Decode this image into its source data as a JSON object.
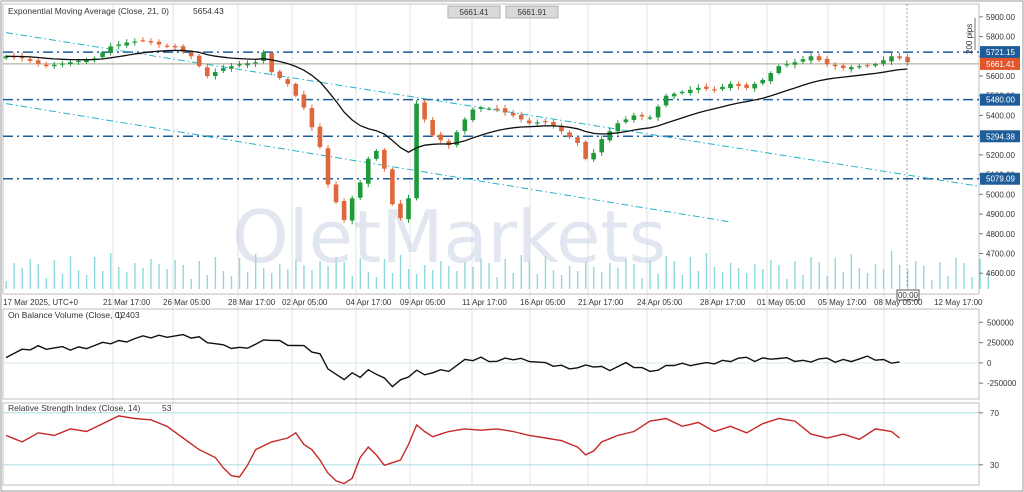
{
  "colors": {
    "up": "#1f9a3a",
    "down": "#e0673b",
    "ema": "#111111",
    "obv": "#111111",
    "rsi": "#c62828",
    "level": "#1e5c9a",
    "trend": "#26b3cc",
    "grid": "#8a8a8a",
    "last_price": "#e3542a",
    "volume": "#8fd7dc"
  },
  "header": {
    "ema_title": "Exponential Moving Average (Close, 21, 0)",
    "ema_value": "5654.43",
    "bid_box": "5661.41",
    "ask_box": "5661.91",
    "pips_label": "200 pips",
    "cursor_time": "00:00"
  },
  "watermark": "OletMarkets",
  "chart_data": [
    {
      "type": "candlestick",
      "title": "Exponential Moving Average (Close, 21, 0)",
      "ylim": [
        4520,
        5960
      ],
      "y_ticks": [
        4600,
        4700,
        4800,
        4900,
        5000,
        5100,
        5200,
        5300,
        5400,
        5500,
        5600,
        5700,
        5800,
        5900
      ],
      "x_labels": [
        "17 Mar 2025, UTC+0",
        "21 Mar 17:00",
        "26 Mar 05:00",
        "28 Mar 17:00",
        "02 Apr 05:00",
        "04 Apr 17:00",
        "09 Apr 05:00",
        "11 Apr 17:00",
        "16 Apr 05:00",
        "21 Apr 17:00",
        "24 Apr 05:00",
        "28 Apr 17:00",
        "01 May 05:00",
        "05 May 17:00",
        "08 May 05:00",
        "12 May 17:00"
      ],
      "price_points": [
        [
          0,
          5700
        ],
        [
          2,
          5690
        ],
        [
          5,
          5650
        ],
        [
          8,
          5670
        ],
        [
          11,
          5690
        ],
        [
          13,
          5750
        ],
        [
          15,
          5770
        ],
        [
          17,
          5780
        ],
        [
          19,
          5760
        ],
        [
          21,
          5745
        ],
        [
          23,
          5700
        ],
        [
          25,
          5600
        ],
        [
          27,
          5640
        ],
        [
          29,
          5660
        ],
        [
          31,
          5670
        ],
        [
          32,
          5720
        ],
        [
          33,
          5620
        ],
        [
          35,
          5560
        ],
        [
          37,
          5440
        ],
        [
          39,
          5240
        ],
        [
          40,
          5050
        ],
        [
          41,
          4960
        ],
        [
          42,
          4870
        ],
        [
          43,
          4980
        ],
        [
          44,
          5060
        ],
        [
          45,
          5180
        ],
        [
          46,
          5220
        ],
        [
          47,
          5130
        ],
        [
          48,
          4950
        ],
        [
          49,
          4880
        ],
        [
          50,
          4980
        ],
        [
          51,
          5460
        ],
        [
          52,
          5380
        ],
        [
          53,
          5300
        ],
        [
          55,
          5250
        ],
        [
          57,
          5380
        ],
        [
          58,
          5430
        ],
        [
          59,
          5440
        ],
        [
          61,
          5430
        ],
        [
          63,
          5400
        ],
        [
          65,
          5360
        ],
        [
          67,
          5370
        ],
        [
          69,
          5320
        ],
        [
          71,
          5260
        ],
        [
          72,
          5180
        ],
        [
          73,
          5210
        ],
        [
          74,
          5280
        ],
        [
          76,
          5360
        ],
        [
          78,
          5400
        ],
        [
          80,
          5390
        ],
        [
          82,
          5500
        ],
        [
          84,
          5520
        ],
        [
          86,
          5540
        ],
        [
          88,
          5530
        ],
        [
          90,
          5560
        ],
        [
          92,
          5540
        ],
        [
          94,
          5580
        ],
        [
          96,
          5650
        ],
        [
          98,
          5670
        ],
        [
          100,
          5700
        ],
        [
          102,
          5660
        ],
        [
          104,
          5640
        ],
        [
          106,
          5650
        ],
        [
          108,
          5660
        ],
        [
          110,
          5700
        ],
        [
          111,
          5690
        ],
        [
          112,
          5670
        ]
      ],
      "ema_period": 21,
      "ema_last": 5654.43,
      "horizontal_levels": [
        5721.15,
        5480.0,
        5294.38,
        5079.09
      ],
      "last_price": 5661.41,
      "trendlines": [
        {
          "from": [
            0,
            5820
          ],
          "to": [
            121,
            5040
          ]
        },
        {
          "from": [
            0,
            5460
          ],
          "to": [
            90,
            4860
          ]
        }
      ]
    },
    {
      "type": "line",
      "title": "On Balance Volume (Close, 0)",
      "last_value": 12403,
      "ylim": [
        -420000,
        640000
      ],
      "y_ticks": [
        500000,
        250000,
        0,
        -250000
      ],
      "points": [
        [
          0,
          90000
        ],
        [
          4,
          200000
        ],
        [
          8,
          170000
        ],
        [
          12,
          230000
        ],
        [
          16,
          300000
        ],
        [
          20,
          340000
        ],
        [
          24,
          310000
        ],
        [
          27,
          200000
        ],
        [
          29,
          180000
        ],
        [
          31,
          230000
        ],
        [
          33,
          290000
        ],
        [
          35,
          240000
        ],
        [
          37,
          190000
        ],
        [
          39,
          100000
        ],
        [
          40,
          -50000
        ],
        [
          41,
          -140000
        ],
        [
          42,
          -230000
        ],
        [
          43,
          -110000
        ],
        [
          44,
          -190000
        ],
        [
          45,
          -60000
        ],
        [
          46,
          -140000
        ],
        [
          47,
          -210000
        ],
        [
          48,
          -280000
        ],
        [
          49,
          -220000
        ],
        [
          50,
          -150000
        ],
        [
          51,
          -90000
        ],
        [
          52,
          -170000
        ],
        [
          53,
          -110000
        ],
        [
          55,
          -80000
        ],
        [
          57,
          20000
        ],
        [
          59,
          60000
        ],
        [
          61,
          20000
        ],
        [
          63,
          50000
        ],
        [
          65,
          40000
        ],
        [
          67,
          -20000
        ],
        [
          69,
          -40000
        ],
        [
          71,
          -60000
        ],
        [
          73,
          -40000
        ],
        [
          75,
          -70000
        ],
        [
          77,
          -20000
        ],
        [
          79,
          -70000
        ],
        [
          81,
          -90000
        ],
        [
          83,
          -20000
        ],
        [
          85,
          -10000
        ],
        [
          87,
          -20000
        ],
        [
          89,
          20000
        ],
        [
          91,
          60000
        ],
        [
          93,
          30000
        ],
        [
          95,
          70000
        ],
        [
          97,
          40000
        ],
        [
          99,
          20000
        ],
        [
          101,
          50000
        ],
        [
          103,
          20000
        ],
        [
          105,
          40000
        ],
        [
          107,
          60000
        ],
        [
          109,
          30000
        ],
        [
          111,
          12403
        ]
      ]
    },
    {
      "type": "line",
      "title": "Relative Strength Index (Close, 14)",
      "last_value": 53,
      "ylim": [
        16,
        76
      ],
      "y_ticks": [
        70,
        30
      ],
      "points": [
        [
          0,
          55
        ],
        [
          2,
          50
        ],
        [
          4,
          57
        ],
        [
          6,
          55
        ],
        [
          8,
          60
        ],
        [
          10,
          58
        ],
        [
          12,
          64
        ],
        [
          14,
          70
        ],
        [
          16,
          68
        ],
        [
          18,
          67
        ],
        [
          20,
          62
        ],
        [
          22,
          53
        ],
        [
          24,
          44
        ],
        [
          26,
          38
        ],
        [
          27,
          30
        ],
        [
          28,
          24
        ],
        [
          29,
          23
        ],
        [
          30,
          32
        ],
        [
          31,
          44
        ],
        [
          33,
          50
        ],
        [
          35,
          53
        ],
        [
          36,
          57
        ],
        [
          37,
          48
        ],
        [
          38,
          44
        ],
        [
          39,
          36
        ],
        [
          40,
          26
        ],
        [
          41,
          20
        ],
        [
          42,
          18
        ],
        [
          43,
          22
        ],
        [
          44,
          38
        ],
        [
          45,
          46
        ],
        [
          46,
          40
        ],
        [
          47,
          32
        ],
        [
          48,
          34
        ],
        [
          49,
          36
        ],
        [
          50,
          48
        ],
        [
          51,
          63
        ],
        [
          52,
          58
        ],
        [
          53,
          54
        ],
        [
          55,
          58
        ],
        [
          57,
          60
        ],
        [
          59,
          59
        ],
        [
          61,
          60
        ],
        [
          63,
          58
        ],
        [
          65,
          55
        ],
        [
          67,
          53
        ],
        [
          69,
          51
        ],
        [
          71,
          46
        ],
        [
          72,
          40
        ],
        [
          73,
          43
        ],
        [
          74,
          50
        ],
        [
          76,
          55
        ],
        [
          78,
          58
        ],
        [
          80,
          66
        ],
        [
          82,
          68
        ],
        [
          84,
          62
        ],
        [
          86,
          65
        ],
        [
          88,
          58
        ],
        [
          90,
          62
        ],
        [
          92,
          57
        ],
        [
          94,
          64
        ],
        [
          96,
          68
        ],
        [
          98,
          66
        ],
        [
          100,
          56
        ],
        [
          102,
          53
        ],
        [
          104,
          56
        ],
        [
          106,
          52
        ],
        [
          108,
          60
        ],
        [
          110,
          58
        ],
        [
          111,
          53
        ]
      ]
    }
  ]
}
